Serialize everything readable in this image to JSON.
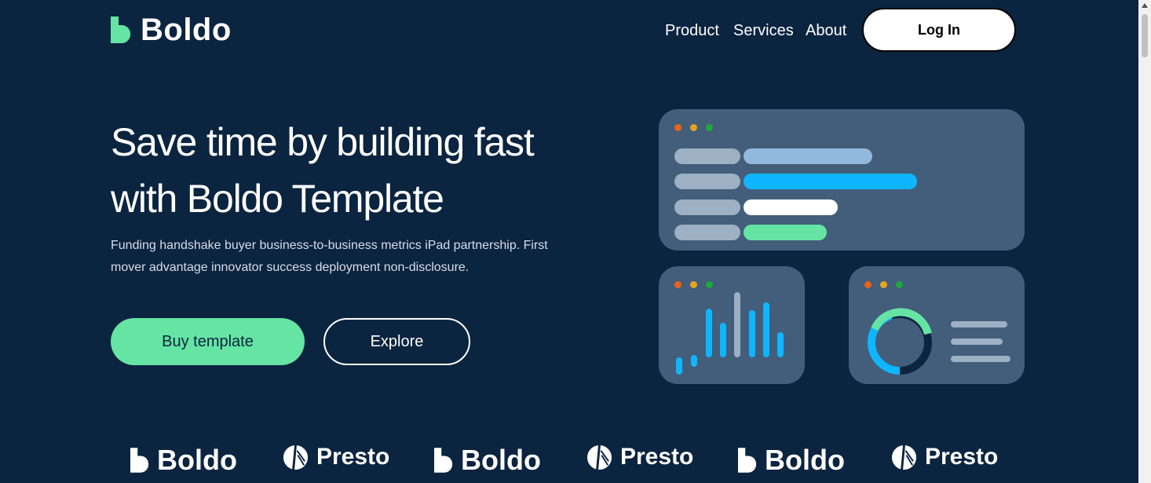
{
  "brand": {
    "name": "Boldo"
  },
  "nav": {
    "items": [
      "Product",
      "Services",
      "About"
    ],
    "login": "Log In"
  },
  "hero": {
    "title_line1": "Save time by building fast",
    "title_line2": "with Boldo Template",
    "subtitle_line1": "Funding handshake buyer business-to-business metrics iPad partnership. First",
    "subtitle_line2": "mover advantage innovator success deployment non-disclosure.",
    "buy_label": "Buy template",
    "explore_label": "Explore"
  },
  "colors": {
    "background": "#0b2440",
    "accent": "#65e4a3",
    "card": "#425e7a",
    "blue": "#0fb6ff"
  },
  "dashboard": {
    "donut_fill": 0.8
  },
  "logos": [
    "Boldo",
    "Presto",
    "Boldo",
    "Presto",
    "Boldo",
    "Presto"
  ]
}
